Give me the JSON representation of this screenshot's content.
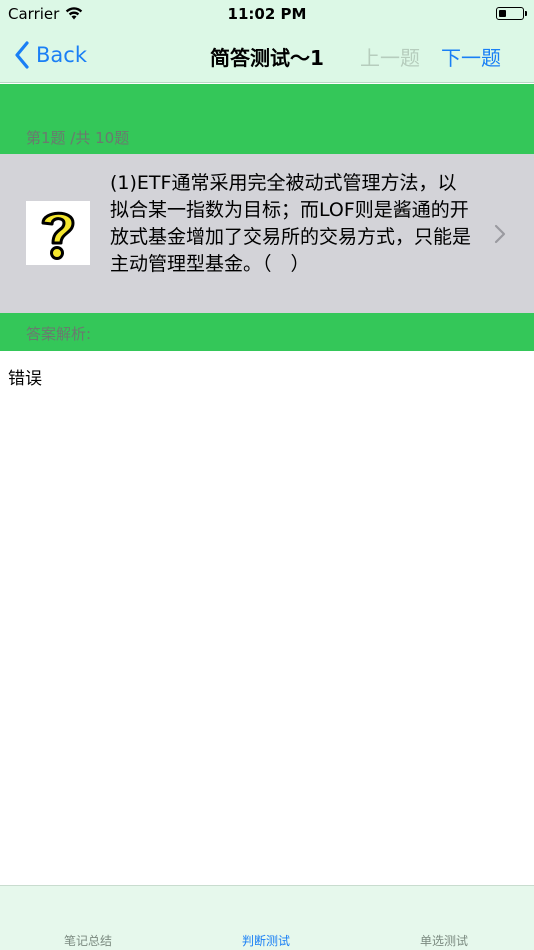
{
  "status_bar": {
    "carrier": "Carrier",
    "time": "11:02 PM"
  },
  "nav": {
    "back_label": "Back",
    "title": "简答测试～1",
    "prev_label": "上一题",
    "next_label": "下一题"
  },
  "progress": {
    "label": "第1题 /共 10题"
  },
  "question": {
    "icon": "question-mark-icon",
    "text": "(1)ETF通常采用完全被动式管理方法，以拟合某一指数为目标；而LOF则是酱通的开放式基金增加了交易所的交易方式，只能是主动管理型基金。（　）"
  },
  "answer": {
    "label": "答案解析:",
    "text": "错误"
  },
  "tabs": [
    {
      "label": "笔记总结",
      "selected": false
    },
    {
      "label": "判断测试",
      "selected": true
    },
    {
      "label": "单选测试",
      "selected": false
    }
  ],
  "colors": {
    "accent": "#1a7ff5",
    "green": "#34c759",
    "cell_gray": "#d3d3d8",
    "nav_bg": "#dcf8e6"
  }
}
